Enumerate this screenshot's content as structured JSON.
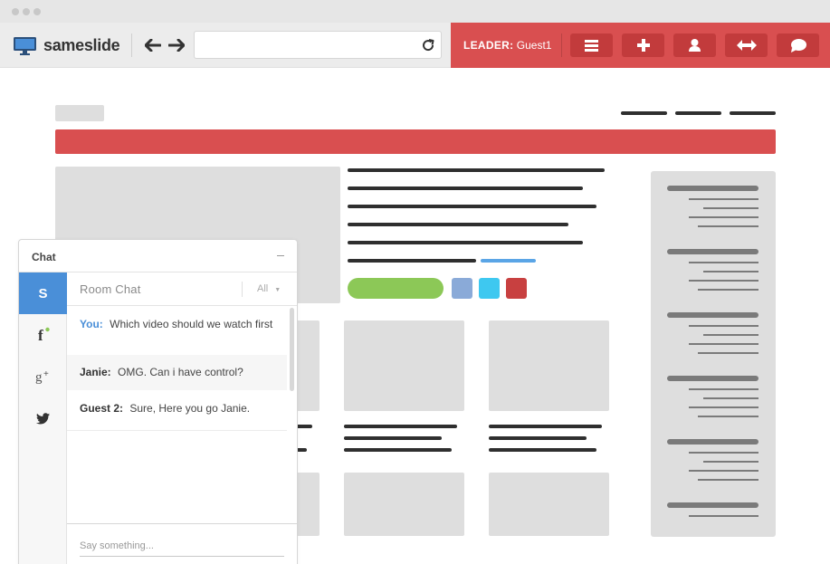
{
  "app": {
    "name": "sameslide"
  },
  "url_bar": {
    "value": "",
    "placeholder": ""
  },
  "leader": {
    "label": "LEADER:",
    "name": "Guest1"
  },
  "chat": {
    "title": "Chat",
    "room_title": "Room Chat",
    "filter": "All",
    "active_network": "S",
    "messages": [
      {
        "sender": "You:",
        "text": "Which video should we watch first"
      },
      {
        "sender": "Janie:",
        "text": "OMG. Can i have control?"
      },
      {
        "sender": "Guest 2:",
        "text": "Sure, Here you go Janie."
      }
    ],
    "input_placeholder": "Say something..."
  },
  "colors": {
    "accent_red": "#d94f50",
    "accent_red_dark": "#c23b3c",
    "accent_blue": "#4a8fd8",
    "green": "#8cc857",
    "swatch_blue": "#8aaad8",
    "swatch_cyan": "#3ec8f0",
    "swatch_red": "#c84040"
  },
  "icons": {
    "logo": "monitor-icon",
    "back": "arrow-left-icon",
    "forward": "arrow-right-icon",
    "reload": "reload-icon",
    "menu": "menu-icon",
    "add": "plus-icon",
    "user": "user-icon",
    "resize": "resize-horizontal-icon",
    "chat": "chat-bubble-icon",
    "facebook": "facebook-icon",
    "google_plus": "google-plus-icon",
    "twitter": "twitter-icon"
  }
}
